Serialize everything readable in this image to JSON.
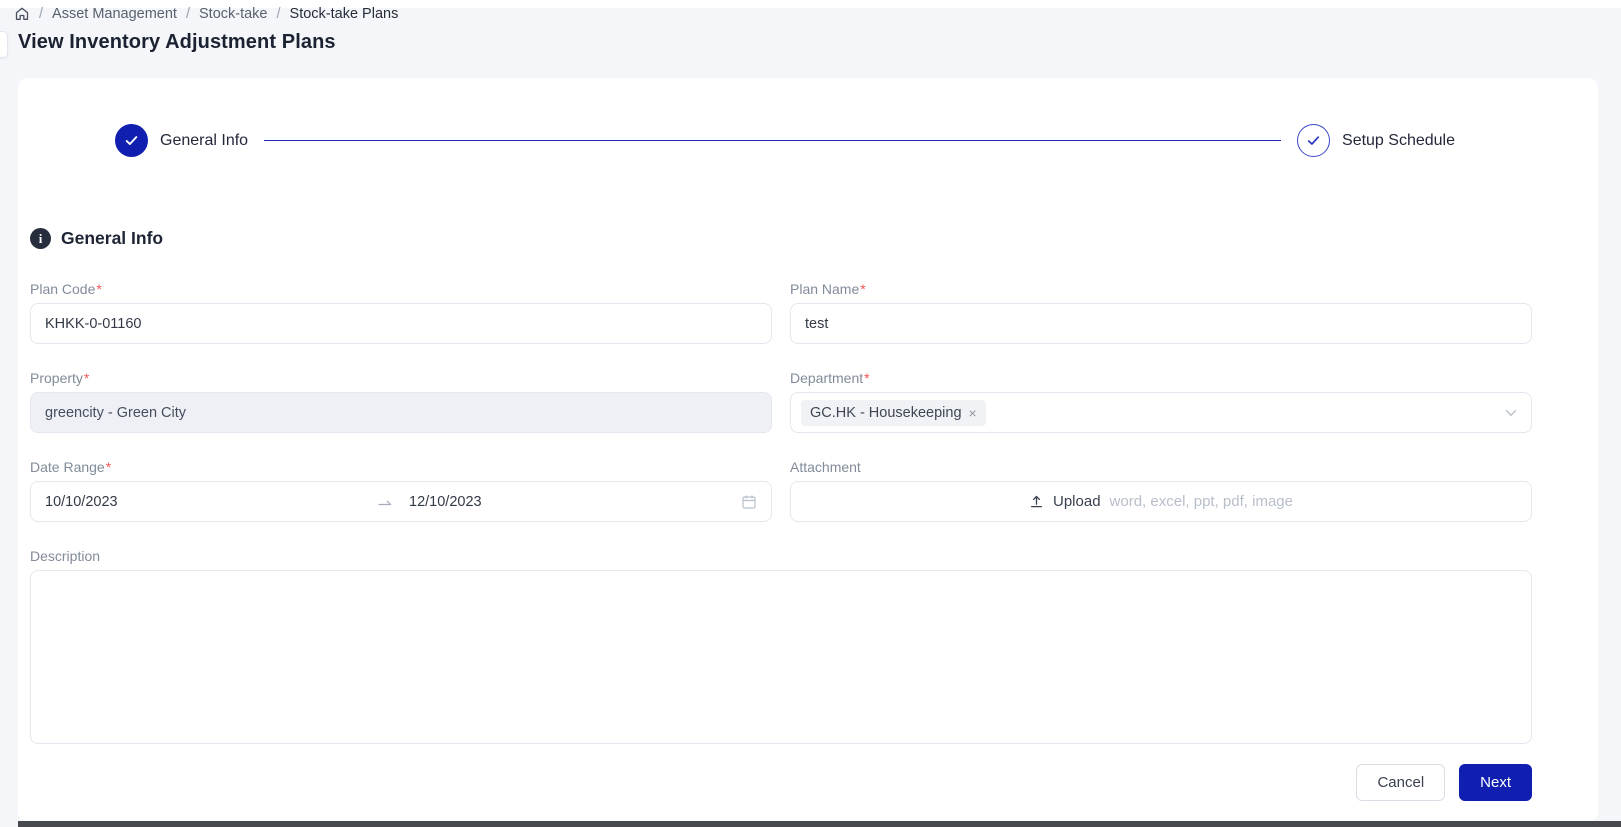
{
  "breadcrumb": {
    "separator": "/",
    "items": [
      "Asset Management",
      "Stock-take",
      "Stock-take Plans"
    ]
  },
  "page": {
    "title": "View Inventory Adjustment Plans"
  },
  "stepper": {
    "steps": [
      {
        "label": "General Info",
        "state": "completed"
      },
      {
        "label": "Setup Schedule",
        "state": "upcoming"
      }
    ]
  },
  "section": {
    "title": "General Info"
  },
  "form": {
    "required_mark": "*",
    "plan_code": {
      "label": "Plan Code",
      "required": true,
      "value": "KHKK-0-01160"
    },
    "plan_name": {
      "label": "Plan Name",
      "required": true,
      "value": "test"
    },
    "property": {
      "label": "Property",
      "required": true,
      "value": "greencity - Green City",
      "disabled": true
    },
    "department": {
      "label": "Department",
      "required": true,
      "selected_tag": "GC.HK - Housekeeping",
      "remove_glyph": "×"
    },
    "date_range": {
      "label": "Date Range",
      "required": true,
      "start": "10/10/2023",
      "end": "12/10/2023"
    },
    "attachment": {
      "label": "Attachment",
      "upload_label": "Upload",
      "hint": "word, excel, ppt, pdf, image"
    },
    "description": {
      "label": "Description",
      "value": ""
    }
  },
  "footer": {
    "cancel_label": "Cancel",
    "next_label": "Next"
  },
  "icons": [
    "home-icon",
    "info-icon",
    "check-icon",
    "chevron-down-icon",
    "close-icon",
    "swap-right-icon",
    "calendar-icon",
    "upload-icon"
  ],
  "colors": {
    "primary": "#101fb0",
    "required": "#f15656",
    "page_bg": "#f4f6f9",
    "disabled_bg": "#eef0f6"
  }
}
